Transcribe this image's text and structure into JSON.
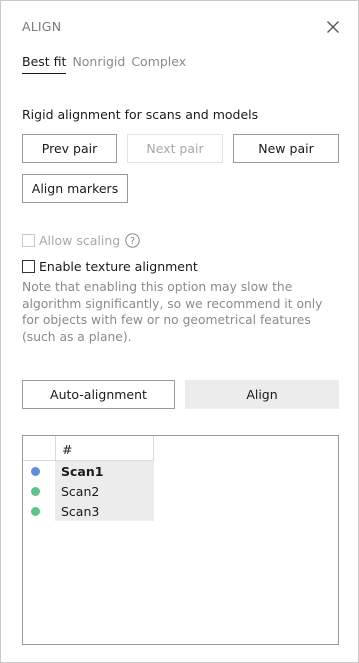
{
  "panel": {
    "title": "ALIGN"
  },
  "tabs": [
    {
      "label": "Best fit",
      "active": true
    },
    {
      "label": "Nonrigid",
      "active": false
    },
    {
      "label": "Complex",
      "active": false
    }
  ],
  "rigid": {
    "label": "Rigid alignment for scans and models",
    "prev_pair": "Prev pair",
    "next_pair": "Next pair",
    "new_pair": "New pair",
    "align_markers": "Align markers"
  },
  "options": {
    "allow_scaling": "Allow scaling",
    "enable_texture": "Enable texture alignment",
    "note": "Note that enabling this option may slow the algorithm significantly, so we recommend it only for objects with few or no geometrical features (such as a plane)."
  },
  "actions": {
    "auto_alignment": "Auto-alignment",
    "align": "Align"
  },
  "table": {
    "header": "#",
    "rows": [
      {
        "name": "Scan1",
        "color": "#5b8fd9",
        "selected": true
      },
      {
        "name": "Scan2",
        "color": "#5cc48a",
        "selected": false
      },
      {
        "name": "Scan3",
        "color": "#5cc48a",
        "selected": false
      }
    ]
  },
  "colors": {
    "text": "#1a1a1a",
    "muted": "#8a8a8a",
    "border": "#9a9a9a",
    "fill": "#ececec"
  }
}
